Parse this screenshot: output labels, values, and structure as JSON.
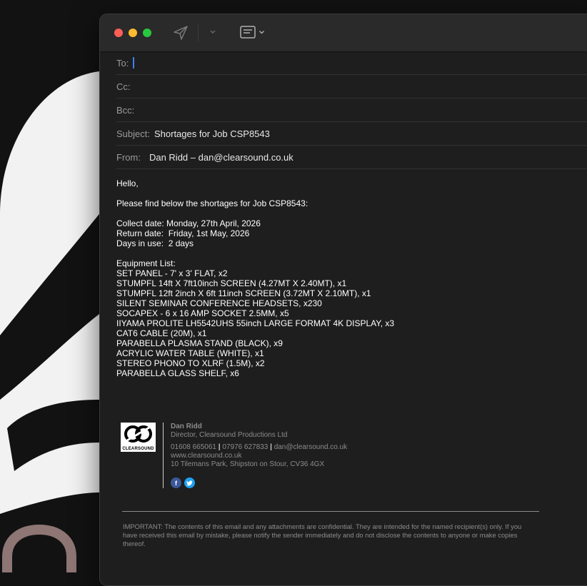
{
  "window": {
    "toolbar": {
      "send_icon": "paper-plane-icon",
      "format_icon": "header-format-icon",
      "chevron_icon": "chevron-down-icon"
    }
  },
  "header": {
    "to_label": "To:",
    "to_value": "",
    "cc_label": "Cc:",
    "bcc_label": "Bcc:",
    "subject_label": "Subject:",
    "subject_value": "Shortages for Job CSP8543",
    "from_label": "From:",
    "from_value": "Dan Ridd – dan@clearsound.co.uk"
  },
  "body": {
    "greeting": "Hello,",
    "intro": "Please find below the shortages for Job CSP8543:",
    "collect_date": "Collect date: Monday, 27th April, 2026",
    "return_date": "Return date:  Friday, 1st May, 2026",
    "days_in_use": "Days in use:  2 days",
    "equipment_heading": "Equipment List:",
    "equipment": [
      "SET PANEL - 7' x 3' FLAT, x2",
      "STUMPFL 14ft X 7ft10inch SCREEN (4.27MT X 2.40MT), x1",
      "STUMPFL 12ft 2inch X 6ft 11inch SCREEN (3.72MT X 2.10MT), x1",
      "SILENT SEMINAR CONFERENCE HEADSETS, x230",
      "SOCAPEX - 6 x 16 AMP SOCKET 2.5MM, x5",
      "IIYAMA PROLITE LH5542UHS 55inch LARGE FORMAT 4K DISPLAY, x3",
      "CAT6 CABLE (20M), x1",
      "PARABELLA PLASMA STAND (BLACK), x9",
      "ACRYLIC WATER TABLE (WHITE), x1",
      "STEREO PHONO TO XLRF (1.5M), x2",
      "PARABELLA GLASS SHELF, x6"
    ]
  },
  "signature": {
    "logo_text": "CLEARSOUND",
    "name": "Dan Ridd",
    "title": "Director, Clearsound Productions Ltd",
    "phone1": "01608 665061",
    "phone2": "07976 627833",
    "email": "dan@clearsound.co.uk",
    "website": "www.clearsound.co.uk",
    "address": "10 Tilemans Park, Shipston on Stour, CV36 4GX",
    "social": {
      "facebook_glyph": "f",
      "twitter_glyph": "t"
    }
  },
  "disclaimer": "IMPORTANT: The contents of this email and any attachments are confidential. They are intended for the named recipient(s) only. If you have received this email by mistake, please notify the sender immediately and do not disclose the contents to anyone or make copies thereof.",
  "colors": {
    "accent_caret": "#3b82f6",
    "facebook": "#3b5998",
    "twitter": "#1da1f2"
  }
}
